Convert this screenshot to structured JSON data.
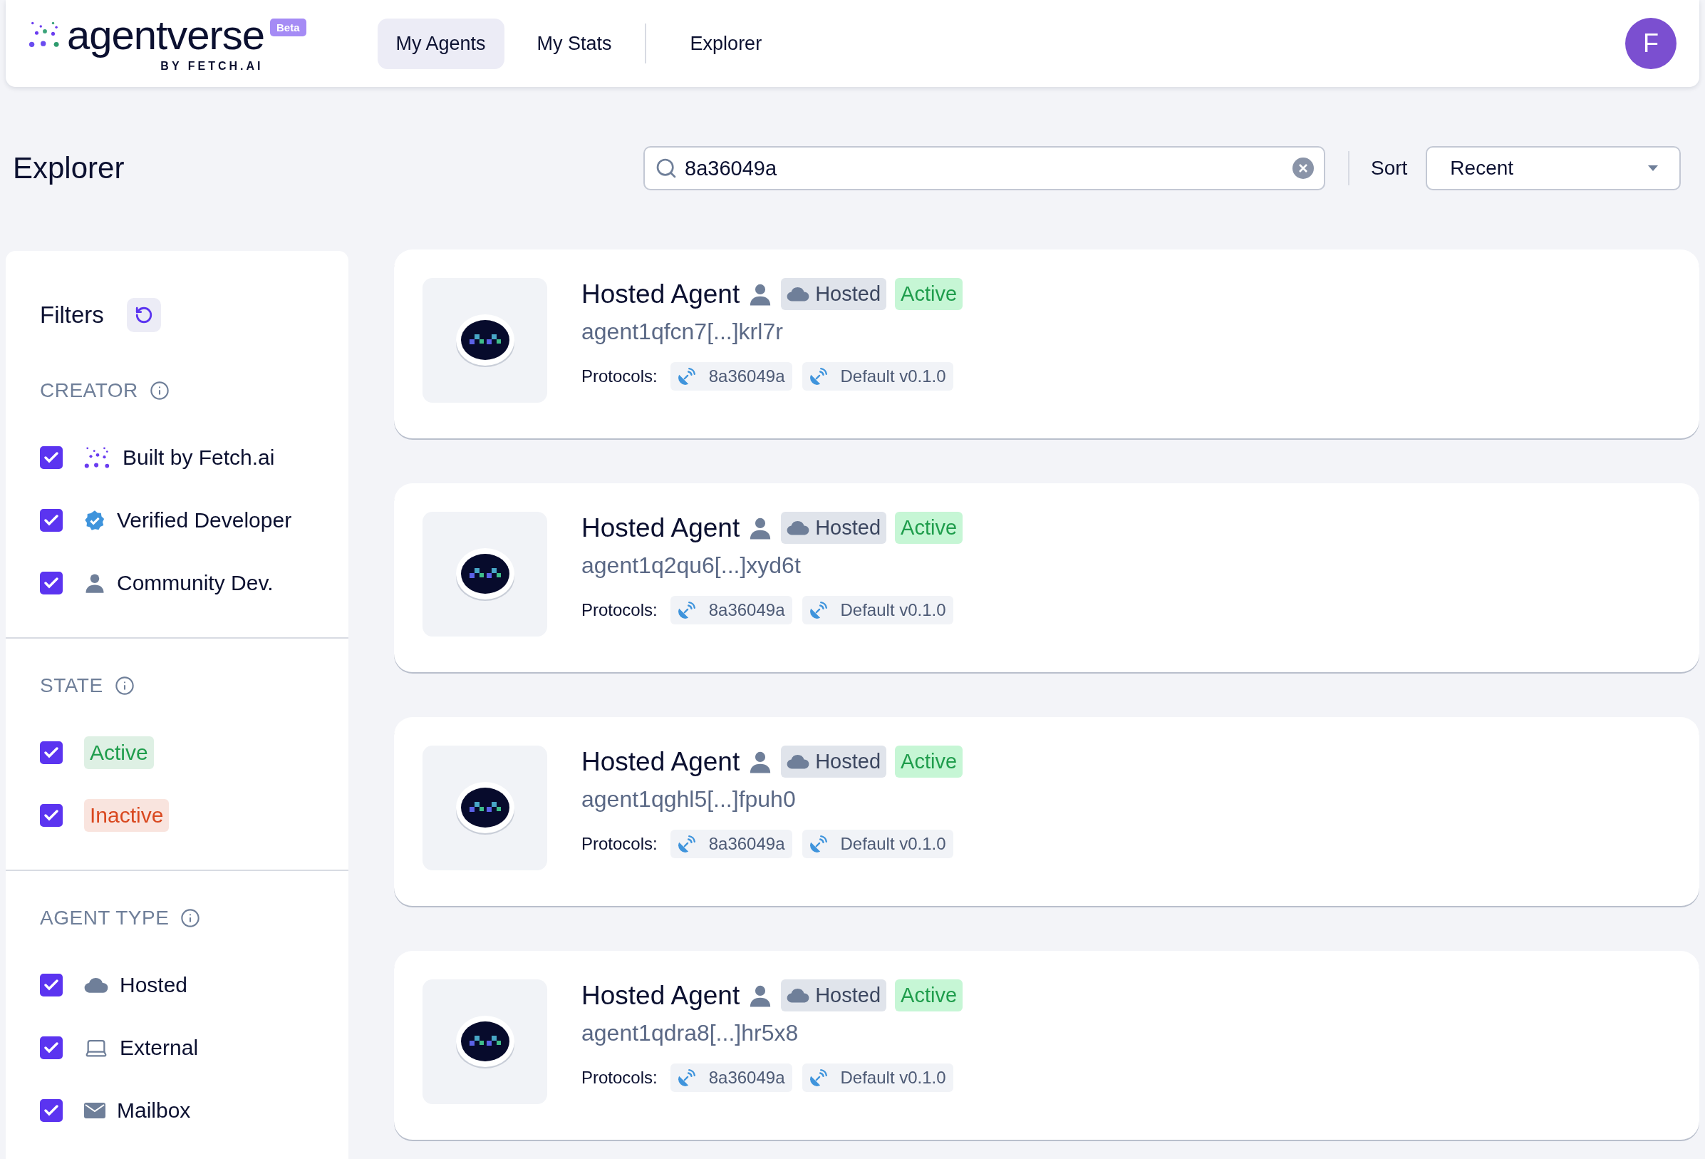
{
  "header": {
    "logo": {
      "name": "agentverse",
      "badge": "Beta",
      "byline": "BY FETCH.AI"
    },
    "nav": [
      {
        "label": "My Agents",
        "selected": true
      },
      {
        "label": "My Stats",
        "selected": false
      },
      {
        "label": "Explorer",
        "selected": false
      }
    ],
    "avatar": "F"
  },
  "page_title": "Explorer",
  "search": {
    "value": "8a36049a"
  },
  "sort": {
    "label": "Sort",
    "value": "Recent"
  },
  "filters": {
    "title": "Filters",
    "groups": [
      {
        "title": "CREATOR",
        "options": [
          {
            "label": "Built by Fetch.ai",
            "kind": "fetch",
            "checked": true
          },
          {
            "label": "Verified Developer",
            "kind": "verified",
            "checked": true
          },
          {
            "label": "Community Dev.",
            "kind": "person",
            "checked": true
          }
        ]
      },
      {
        "title": "STATE",
        "options": [
          {
            "label": "Active",
            "kind": "tag",
            "color": "#1f9d4c",
            "checked": true
          },
          {
            "label": "Inactive",
            "kind": "tag",
            "color": "#d9481f",
            "checked": true
          }
        ]
      },
      {
        "title": "AGENT TYPE",
        "options": [
          {
            "label": "Hosted",
            "kind": "cloud",
            "checked": true
          },
          {
            "label": "External",
            "kind": "laptop",
            "checked": true
          },
          {
            "label": "Mailbox",
            "kind": "mail",
            "checked": true
          }
        ]
      }
    ]
  },
  "agents": [
    {
      "name": "Hosted Agent",
      "type": "Hosted",
      "status": "Active",
      "active": true,
      "address": "agent1qfcn7[...]krl7r",
      "protocols_label": "Protocols:",
      "protocols": [
        "8a36049a",
        "Default v0.1.0"
      ]
    },
    {
      "name": "Hosted Agent",
      "type": "Hosted",
      "status": "Active",
      "active": true,
      "address": "agent1q2qu6[...]xyd6t",
      "protocols_label": "Protocols:",
      "protocols": [
        "8a36049a",
        "Default v0.1.0"
      ]
    },
    {
      "name": "Hosted Agent",
      "type": "Hosted",
      "status": "Active",
      "active": true,
      "address": "agent1qghl5[...]fpuh0",
      "protocols_label": "Protocols:",
      "protocols": [
        "8a36049a",
        "Default v0.1.0"
      ]
    },
    {
      "name": "Hosted Agent",
      "type": "Hosted",
      "status": "Active",
      "active": true,
      "address": "agent1qdra8[...]hr5x8",
      "protocols_label": "Protocols:",
      "protocols": [
        "8a36049a",
        "Default v0.1.0"
      ]
    }
  ]
}
